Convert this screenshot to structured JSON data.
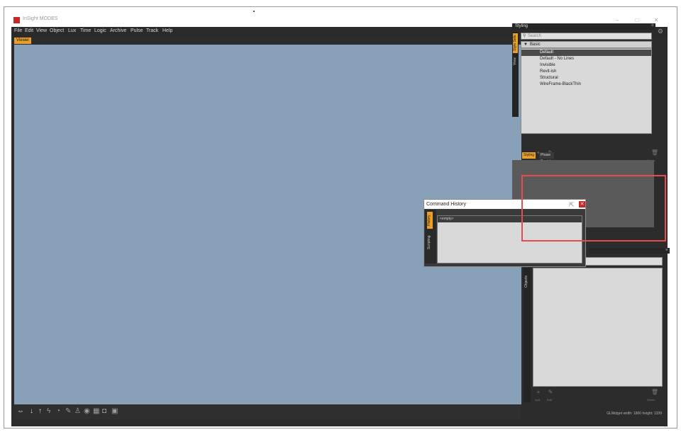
{
  "app": {
    "title": "InSight MODES",
    "menu": [
      "File",
      "Edit",
      "View",
      "Object",
      "Lux",
      "Time",
      "Logic",
      "Archive",
      "Pulse",
      "Track",
      "Help"
    ],
    "viewer_tab": "Viewer",
    "status": "GLWidget  width: 1800    height: 1339",
    "window_buttons": {
      "minimize": "–",
      "maximize": "□",
      "close": "✕"
    }
  },
  "right_panel": {
    "title": "Styling",
    "close": "⊗",
    "vertical_tabs": [
      "Style Sets",
      "View"
    ],
    "search_placeholder": "Search",
    "group_label": "Basic",
    "group_arrow": "▼",
    "items": [
      "Default",
      "Default - No Lines",
      "Invisible",
      "Revit-ish",
      "Structural",
      "WireFrame-BlackThin"
    ],
    "selected_index": 0,
    "add_label": "Add",
    "edit_label": "Edit",
    "delete_label": "Delete",
    "panel_tabs": [
      "Styling",
      "Phase Presets"
    ],
    "second_vertical_tab": "Objects",
    "second_close": "⊗"
  },
  "command_history": {
    "title": "Command History",
    "vertical_tabs": [
      "History",
      "Scripting"
    ],
    "empty_text": "<empty>",
    "close": "✕"
  },
  "colors": {
    "accent": "#e8a02a",
    "viewport": "#88a0b8",
    "highlight": "#e64c4c"
  }
}
